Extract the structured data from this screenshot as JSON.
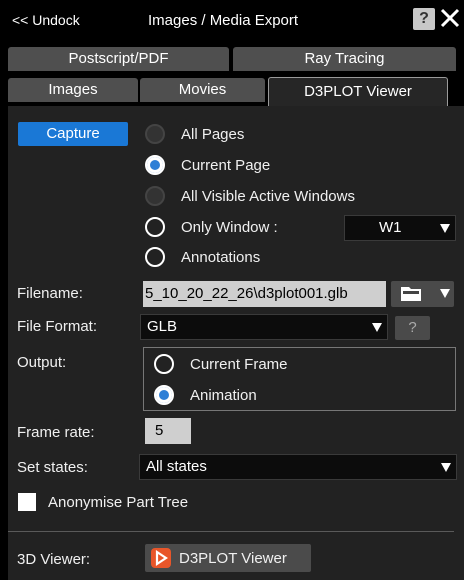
{
  "header": {
    "undock_label": "<< Undock",
    "title": "Images / Media Export",
    "help_label": "?",
    "close_label": "✕"
  },
  "tabs": {
    "row1": [
      "Postscript/PDF",
      "Ray Tracing"
    ],
    "row2": [
      "Images",
      "Movies",
      "D3PLOT Viewer"
    ],
    "active": "D3PLOT Viewer"
  },
  "capture": {
    "button_label": "Capture",
    "options": [
      {
        "label": "All Pages",
        "state": "disabled"
      },
      {
        "label": "Current Page",
        "state": "selected"
      },
      {
        "label": "All Visible Active Windows",
        "state": "disabled"
      },
      {
        "label": "Only Window :",
        "state": "unselected"
      },
      {
        "label": "Annotations",
        "state": "unselected"
      }
    ],
    "window_select": "W1"
  },
  "filename": {
    "label": "Filename:",
    "value": "5_10_20_22_26\\d3plot001.glb"
  },
  "file_format": {
    "label": "File Format:",
    "value": "GLB",
    "help_label": "?"
  },
  "output": {
    "label": "Output:",
    "options": [
      {
        "label": "Current Frame",
        "state": "unselected"
      },
      {
        "label": "Animation",
        "state": "selected"
      }
    ]
  },
  "frame_rate": {
    "label": "Frame rate:",
    "value": "5"
  },
  "set_states": {
    "label": "Set states:",
    "value": "All states"
  },
  "anonymise": {
    "label": "Anonymise Part Tree",
    "checked": false
  },
  "viewer": {
    "label": "3D Viewer:",
    "button_label": "D3PLOT Viewer",
    "icon": "play-icon"
  },
  "colors": {
    "accent": "#1a78d6",
    "background": "#222222",
    "viewer_icon": "#e8562a"
  }
}
